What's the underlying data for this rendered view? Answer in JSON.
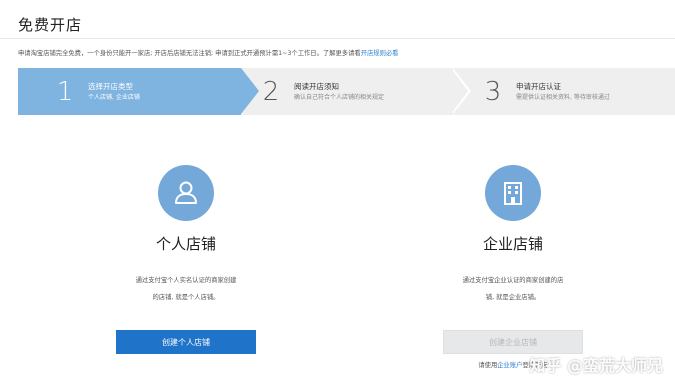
{
  "page": {
    "title": "免费开店",
    "notice": "申请淘宝店铺完全免费，一个身份只能开一家店; 开店后店铺无法注销; 申请到正式开通预计需1~3个工作日。了解更多请看",
    "notice_link": "开店规则必看"
  },
  "steps": [
    {
      "number": "1",
      "title": "选择开店类型",
      "desc": "个人店铺, 企业店铺"
    },
    {
      "number": "2",
      "title": "阅读开店须知",
      "desc": "确认自己符合个人店铺的相关规定"
    },
    {
      "number": "3",
      "title": "申请开店认证",
      "desc": "需提供认证相关资料, 等待审核通过"
    }
  ],
  "personal": {
    "icon": "person-icon",
    "title": "个人店铺",
    "desc_line1": "通过支付宝个人实名认证的商家创建",
    "desc_line2": "的店铺, 就是个人店铺。",
    "button": "创建个人店铺"
  },
  "enterprise": {
    "icon": "building-icon",
    "title": "企业店铺",
    "desc_line1": "通过支付宝企业认证的商家创建的店",
    "desc_line2": "铺, 就是企业店铺。",
    "button": "创建企业店铺",
    "note_prefix": "请使用",
    "note_link": "企业账户",
    "note_suffix": "登陆开店"
  },
  "watermark": "知乎 @蛮荒大师兄",
  "colors": {
    "accent": "#1f73c9",
    "step_active": "#7fb3e0",
    "icon_bg": "#74a8d8"
  }
}
